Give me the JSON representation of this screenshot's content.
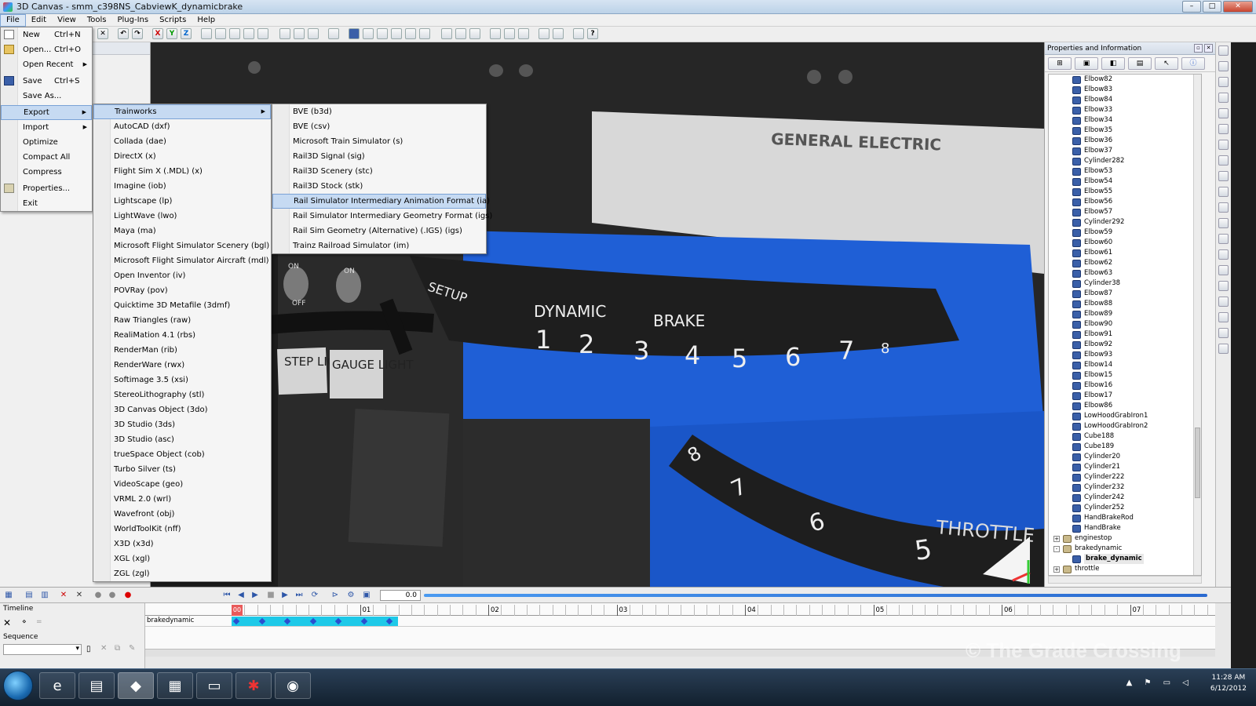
{
  "window": {
    "title": "3D Canvas - smm_c398NS_CabviewK_dynamicbrake"
  },
  "menubar": [
    "File",
    "Edit",
    "View",
    "Tools",
    "Plug-Ins",
    "Scripts",
    "Help"
  ],
  "file_menu": [
    {
      "label": "New",
      "shortcut": "Ctrl+N",
      "icon": "new-file-icon"
    },
    {
      "label": "Open...",
      "shortcut": "Ctrl+O",
      "icon": "open-folder-icon"
    },
    {
      "label": "Open Recent",
      "submenu": true
    },
    {
      "label": "Save",
      "shortcut": "Ctrl+S",
      "icon": "save-icon"
    },
    {
      "label": "Save As..."
    },
    {
      "label": "Export",
      "submenu": true,
      "highlighted": true
    },
    {
      "label": "Import",
      "submenu": true
    },
    {
      "label": "Optimize"
    },
    {
      "label": "Compact All"
    },
    {
      "label": "Compress"
    },
    {
      "label": "Properties...",
      "icon": "properties-icon"
    },
    {
      "label": "Exit"
    }
  ],
  "export_menu": [
    "Trainworks",
    "AutoCAD (dxf)",
    "Collada (dae)",
    "DirectX (x)",
    "Flight Sim X (.MDL) (x)",
    "Imagine (iob)",
    "Lightscape (lp)",
    "LightWave (lwo)",
    "Maya (ma)",
    "Microsoft Flight Simulator Scenery (bgl)",
    "Microsoft Flight Simulator Aircraft (mdl)",
    "Open Inventor (iv)",
    "POVRay (pov)",
    "Quicktime 3D Metafile (3dmf)",
    "Raw Triangles (raw)",
    "RealiMation 4.1 (rbs)",
    "RenderMan (rib)",
    "RenderWare (rwx)",
    "Softimage 3.5 (xsi)",
    "StereoLithography (stl)",
    "3D Canvas Object (3do)",
    "3D Studio (3ds)",
    "3D Studio (asc)",
    "trueSpace Object (cob)",
    "Turbo Silver (ts)",
    "VideoScape (geo)",
    "VRML 2.0 (wrl)",
    "Wavefront (obj)",
    "WorldToolKit (nff)",
    "X3D (x3d)",
    "XGL (xgl)",
    "ZGL (zgl)"
  ],
  "trainworks_menu": [
    "BVE (b3d)",
    "BVE (csv)",
    "Microsoft Train Simulator (s)",
    "Rail3D Signal (sig)",
    "Rail3D Scenery (stc)",
    "Rail3D Stock (stk)",
    "Rail Simulator Intermediary Animation Format (ia)",
    "Rail Simulator Intermediary Geometry Format (igs)",
    "Rail Sim Geometry (Alternative) (.IGS) (igs)",
    "Trainz Railroad Simulator (im)"
  ],
  "trainworks_highlighted": "Rail Simulator Intermediary Animation Format (ia)",
  "viewport": {
    "plate_text": "GENERAL ELECTRIC",
    "dial_setup": "SETUP",
    "dial_dynamic": "DYNAMIC",
    "dial_brake": "BRAKE",
    "dial_numbers": [
      "1",
      "2",
      "3",
      "4",
      "5",
      "6",
      "7",
      "8"
    ],
    "lower_dial_numbers": [
      "8",
      "7",
      "6",
      "5"
    ],
    "lower_dial_label": "THROTTLE",
    "switch_on": "ON",
    "switch_off": "OFF",
    "step_light": "STEP LIGHT",
    "gauge_light": "GAUGE LIGHT"
  },
  "properties": {
    "title": "Properties and Information",
    "tree": [
      {
        "label": "Elbow82"
      },
      {
        "label": "Elbow83"
      },
      {
        "label": "Elbow84"
      },
      {
        "label": "Elbow33"
      },
      {
        "label": "Elbow34"
      },
      {
        "label": "Elbow35"
      },
      {
        "label": "Elbow36"
      },
      {
        "label": "Elbow37"
      },
      {
        "label": "Cylinder282"
      },
      {
        "label": "Elbow53"
      },
      {
        "label": "Elbow54"
      },
      {
        "label": "Elbow55"
      },
      {
        "label": "Elbow56"
      },
      {
        "label": "Elbow57"
      },
      {
        "label": "Cylinder292"
      },
      {
        "label": "Elbow59"
      },
      {
        "label": "Elbow60"
      },
      {
        "label": "Elbow61"
      },
      {
        "label": "Elbow62"
      },
      {
        "label": "Elbow63"
      },
      {
        "label": "Cylinder38"
      },
      {
        "label": "Elbow87"
      },
      {
        "label": "Elbow88"
      },
      {
        "label": "Elbow89"
      },
      {
        "label": "Elbow90"
      },
      {
        "label": "Elbow91"
      },
      {
        "label": "Elbow92"
      },
      {
        "label": "Elbow93"
      },
      {
        "label": "Elbow14"
      },
      {
        "label": "Elbow15"
      },
      {
        "label": "Elbow16"
      },
      {
        "label": "Elbow17"
      },
      {
        "label": "Elbow86"
      },
      {
        "label": "LowHoodGrabIron1"
      },
      {
        "label": "LowHoodGrabIron2"
      },
      {
        "label": "Cube188"
      },
      {
        "label": "Cube189"
      },
      {
        "label": "Cylinder20"
      },
      {
        "label": "Cylinder21"
      },
      {
        "label": "Cylinder222"
      },
      {
        "label": "Cylinder232"
      },
      {
        "label": "Cylinder242"
      },
      {
        "label": "Cylinder252"
      },
      {
        "label": "HandBrakeRod"
      },
      {
        "label": "HandBrake"
      },
      {
        "label": "enginestop",
        "group": true,
        "expander": "+"
      },
      {
        "label": "brakedynamic",
        "group": true,
        "expander": "-"
      },
      {
        "label": "brake_dynamic",
        "selected": true
      },
      {
        "label": "throttle",
        "group": true,
        "expander": "+"
      }
    ]
  },
  "timeline": {
    "label": "Timeline",
    "sequence_label": "Sequence",
    "time_value": "0.0",
    "ruler": [
      "00",
      "01",
      "02",
      "03",
      "04",
      "05",
      "06",
      "07"
    ],
    "track": "brakedynamic"
  },
  "watermark": "© The Grade Crossing",
  "taskbar": {
    "time": "11:28 AM",
    "date": "6/12/2012"
  }
}
